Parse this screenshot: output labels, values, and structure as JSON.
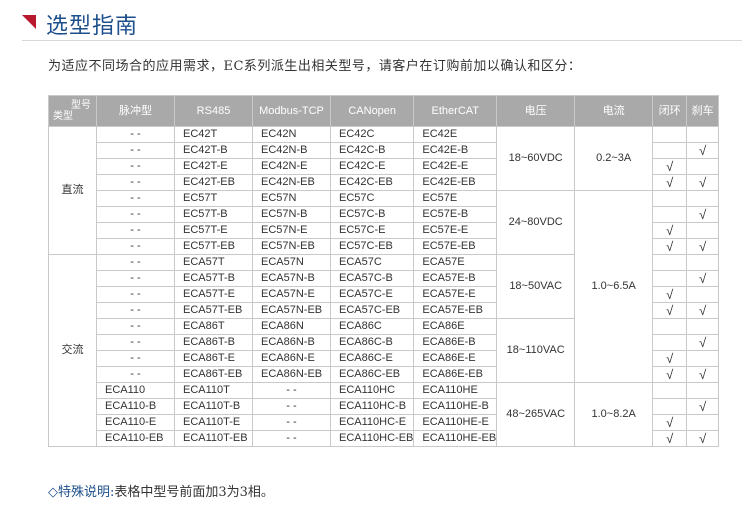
{
  "page": {
    "title": "选型指南",
    "subtitle": "为适应不同场合的应用需求，EC系列派生出相关型号，请客户在订购前加以确认和区分：",
    "note_label": "◇特殊说明:",
    "note_text": "表格中型号前面加3为3相。"
  },
  "colors": {
    "title": "#1d4f8c",
    "accent": "#b8192e",
    "header_bg": "#a9a9a9"
  },
  "table": {
    "corner_top": "型号",
    "corner_bottom": "类型",
    "headers": [
      "脉冲型",
      "RS485",
      "Modbus-TCP",
      "CANopen",
      "EtherCAT",
      "电压",
      "电流",
      "闭环",
      "刹车"
    ],
    "types": [
      "直流",
      "交流"
    ],
    "voltages": [
      "18~60VDC",
      "24~80VDC",
      "18~50VAC",
      "18~110VAC",
      "48~265VAC"
    ],
    "currents": [
      "0.2~3A",
      "1.0~6.5A",
      "1.0~8.2A"
    ],
    "check": "√",
    "rows": [
      [
        "- -",
        "EC42T",
        "EC42N",
        "EC42C",
        "EC42E"
      ],
      [
        "- -",
        "EC42T-B",
        "EC42N-B",
        "EC42C-B",
        "EC42E-B"
      ],
      [
        "- -",
        "EC42T-E",
        "EC42N-E",
        "EC42C-E",
        "EC42E-E"
      ],
      [
        "- -",
        "EC42T-EB",
        "EC42N-EB",
        "EC42C-EB",
        "EC42E-EB"
      ],
      [
        "- -",
        "EC57T",
        "EC57N",
        "EC57C",
        "EC57E"
      ],
      [
        "- -",
        "EC57T-B",
        "EC57N-B",
        "EC57C-B",
        "EC57E-B"
      ],
      [
        "- -",
        "EC57T-E",
        "EC57N-E",
        "EC57C-E",
        "EC57E-E"
      ],
      [
        "- -",
        "EC57T-EB",
        "EC57N-EB",
        "EC57C-EB",
        "EC57E-EB"
      ],
      [
        "- -",
        "ECA57T",
        "ECA57N",
        "ECA57C",
        "ECA57E"
      ],
      [
        "- -",
        "ECA57T-B",
        "ECA57N-B",
        "ECA57C-B",
        "ECA57E-B"
      ],
      [
        "- -",
        "ECA57T-E",
        "ECA57N-E",
        "ECA57C-E",
        "ECA57E-E"
      ],
      [
        "- -",
        "ECA57T-EB",
        "ECA57N-EB",
        "ECA57C-EB",
        "ECA57E-EB"
      ],
      [
        "- -",
        "ECA86T",
        "ECA86N",
        "ECA86C",
        "ECA86E"
      ],
      [
        "- -",
        "ECA86T-B",
        "ECA86N-B",
        "ECA86C-B",
        "ECA86E-B"
      ],
      [
        "- -",
        "ECA86T-E",
        "ECA86N-E",
        "ECA86C-E",
        "ECA86E-E"
      ],
      [
        "- -",
        "ECA86T-EB",
        "ECA86N-EB",
        "ECA86C-EB",
        "ECA86E-EB"
      ],
      [
        "ECA110",
        "ECA110T",
        "- -",
        "ECA110HC",
        "ECA110HE"
      ],
      [
        "ECA110-B",
        "ECA110T-B",
        "- -",
        "ECA110HC-B",
        "ECA110HE-B"
      ],
      [
        "ECA110-E",
        "ECA110T-E",
        "- -",
        "ECA110HC-E",
        "ECA110HE-E"
      ],
      [
        "ECA110-EB",
        "ECA110T-EB",
        "- -",
        "ECA110HC-EB",
        "ECA110HE-EB"
      ]
    ]
  }
}
